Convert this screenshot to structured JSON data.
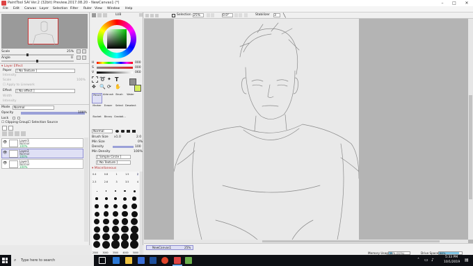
{
  "window": {
    "title": "PaintTool SAI Ver.2 (32bit) Preview.2017.08.20 - NewCanvas1 (*)"
  },
  "menu": [
    "File",
    "Edit",
    "Canvas",
    "Layer",
    "Selection",
    "Filter",
    "Ruler",
    "View",
    "Window",
    "Help"
  ],
  "navigator": {
    "scale_label": "Scale",
    "scale_value": "25%",
    "angle_label": "Angle",
    "angle_value": "0"
  },
  "layer_effect": {
    "header": "Layer Effect",
    "paper_label": "Paper",
    "paper_value": "[ No Texture ]",
    "intensity_label": "Intensity",
    "scale_label": "Scale",
    "scale_value": "100%",
    "apply_label": "Apply to Linework",
    "effect_label": "Effect",
    "effect_value": "[ No effect ]",
    "width_label": "Width",
    "eff_intensity_label": "Intensity"
  },
  "layer_props": {
    "mode_label": "Mode",
    "mode_value": "Normal",
    "opacity_label": "Opacity",
    "opacity_value": "100%",
    "lock_label": "Lock",
    "clipping_label": "Clipping Group",
    "selection_source_label": "Selection Source"
  },
  "layers": [
    {
      "name": "Layer3",
      "mode": "Normal",
      "opacity": "100%"
    },
    {
      "name": "Layer2",
      "mode": "Normal",
      "opacity": "100%"
    },
    {
      "name": "Layer1",
      "mode": "Normal",
      "opacity": "100%"
    }
  ],
  "color": {
    "tab_label": "LUB",
    "h_label": "H",
    "h_value": "000",
    "s_label": "S",
    "s_value": "000",
    "v_label": "V",
    "v_value": "060"
  },
  "tools": {
    "pencil": "Pencil",
    "airbrush": "Airbrush",
    "brush": "Brush",
    "water": "Water",
    "marker": "Marker",
    "eraser": "Eraser",
    "select": "Select",
    "deselect": "Deselect",
    "bucket": "Bucket",
    "binary": "Binary",
    "gradation": "Gradati..."
  },
  "brush": {
    "mode_value": "Normal",
    "size_label": "Brush Size",
    "size_mult": "x1.0",
    "size_value": "2.0",
    "min_size_label": "Min Size",
    "min_size_value": "0%",
    "density_label": "Density",
    "density_value": "100",
    "min_density_label": "Min Density",
    "min_density_value": "100%",
    "shape_value": "[ Simple Circle ]",
    "texture_value": "[ No Texture ]",
    "misc_label": "Miscellaneous",
    "presets_row1": [
      "0.4",
      "0.8",
      "1",
      "1.5",
      "2"
    ],
    "presets_row2": [
      "2.3",
      "2.6",
      "3",
      "3.5",
      "4"
    ],
    "presets_last": [
      "2500",
      "3000",
      "3500",
      "4000",
      "5000"
    ]
  },
  "canvas_toolbar": {
    "selection_label": "Selection",
    "zoom_value": "25%",
    "angle_value": "0.0°",
    "stabilizer_label": "Stabilizer",
    "stabilizer_value": "3"
  },
  "status": {
    "canvas_tab": "NewCanvas1",
    "canvas_zoom": "25%",
    "memory_label": "Memory Usage",
    "memory_value": "16% (22%)",
    "drive_label": "Drive Space",
    "drive_value": "88%"
  },
  "taskbar": {
    "search_placeholder": "Type here to search",
    "time": "5:33 PM",
    "date": "10/1/2019"
  },
  "colors": {
    "accent": "#8c8cd0",
    "taskbar": "#0d0f14",
    "current_color": "#8f8f8f",
    "secondary_color": "#d6ee5a"
  }
}
